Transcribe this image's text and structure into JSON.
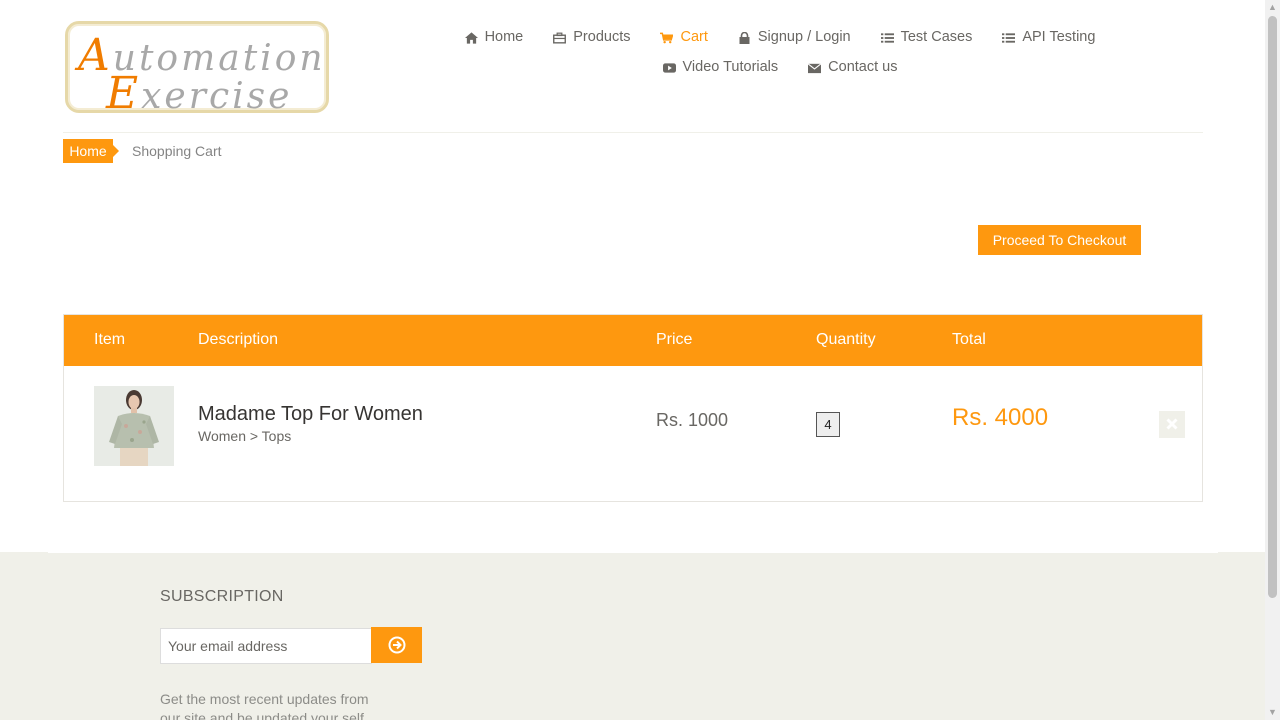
{
  "logo": {
    "line1_cap": "A",
    "line1_rest": "utomation",
    "line2_cap": "E",
    "line2_rest": "xercise",
    "brand_colors": {
      "orange": "#f07c00",
      "gray": "#a8a8a8",
      "border": "#e6d8a8"
    }
  },
  "nav": {
    "items": [
      {
        "label": "Home",
        "icon": "home-icon"
      },
      {
        "label": "Products",
        "icon": "products-icon"
      },
      {
        "label": "Cart",
        "icon": "cart-icon",
        "active": true
      },
      {
        "label": "Signup / Login",
        "icon": "lock-icon"
      },
      {
        "label": "Test Cases",
        "icon": "list-icon"
      },
      {
        "label": "API Testing",
        "icon": "list-icon"
      },
      {
        "label": "Video Tutorials",
        "icon": "youtube-play-icon"
      },
      {
        "label": "Contact us",
        "icon": "envelope-icon"
      }
    ]
  },
  "breadcrumb": {
    "home": "Home",
    "current": "Shopping Cart"
  },
  "checkout": {
    "label": "Proceed To Checkout"
  },
  "cart": {
    "headers": {
      "item": "Item",
      "description": "Description",
      "price": "Price",
      "quantity": "Quantity",
      "total": "Total"
    },
    "rows": [
      {
        "name": "Madame Top For Women",
        "category": "Women > Tops",
        "price": "Rs. 1000",
        "quantity": "4",
        "total": "Rs. 4000",
        "image": "product-thumbnail"
      }
    ]
  },
  "subscription": {
    "title": "SUBSCRIPTION",
    "placeholder": "Your email address",
    "button_icon": "arrow-circle-right-icon",
    "text": "Get the most recent updates from our site and be updated your self..."
  },
  "colors": {
    "accent": "#FE980F",
    "text": "#696763",
    "footer_bg": "#f0f0e9"
  }
}
